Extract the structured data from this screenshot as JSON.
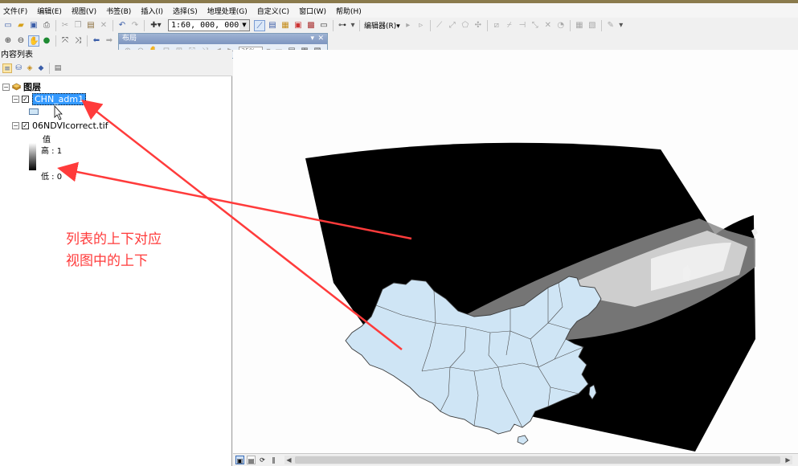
{
  "menu": [
    "文件(F)",
    "编辑(E)",
    "视图(V)",
    "书签(B)",
    "插入(I)",
    "选择(S)",
    "地理处理(G)",
    "自定义(C)",
    "窗口(W)",
    "帮助(H)"
  ],
  "toolbar": {
    "scale_value": "1:60, 000, 000",
    "editor_label": "编辑器(R)▾"
  },
  "layout_toolbar": {
    "title": "布局",
    "zoom_percent": "35%"
  },
  "toc": {
    "title": "内容列表",
    "root_label": "图层",
    "layers": [
      {
        "name": "CHN_adm1",
        "checked": true,
        "selected": true
      },
      {
        "name": "06NDVIcorrect.tif",
        "checked": true,
        "selected": false
      }
    ],
    "legend": {
      "heading": "值",
      "high": "高 : 1",
      "low": "低 : 0"
    }
  },
  "annotation": {
    "line1": "列表的上下对应",
    "line2": "视图中的上下",
    "color": "#ff3b3b"
  },
  "colors": {
    "china_fill": "#cfe5f5",
    "selection": "#3399ff"
  }
}
